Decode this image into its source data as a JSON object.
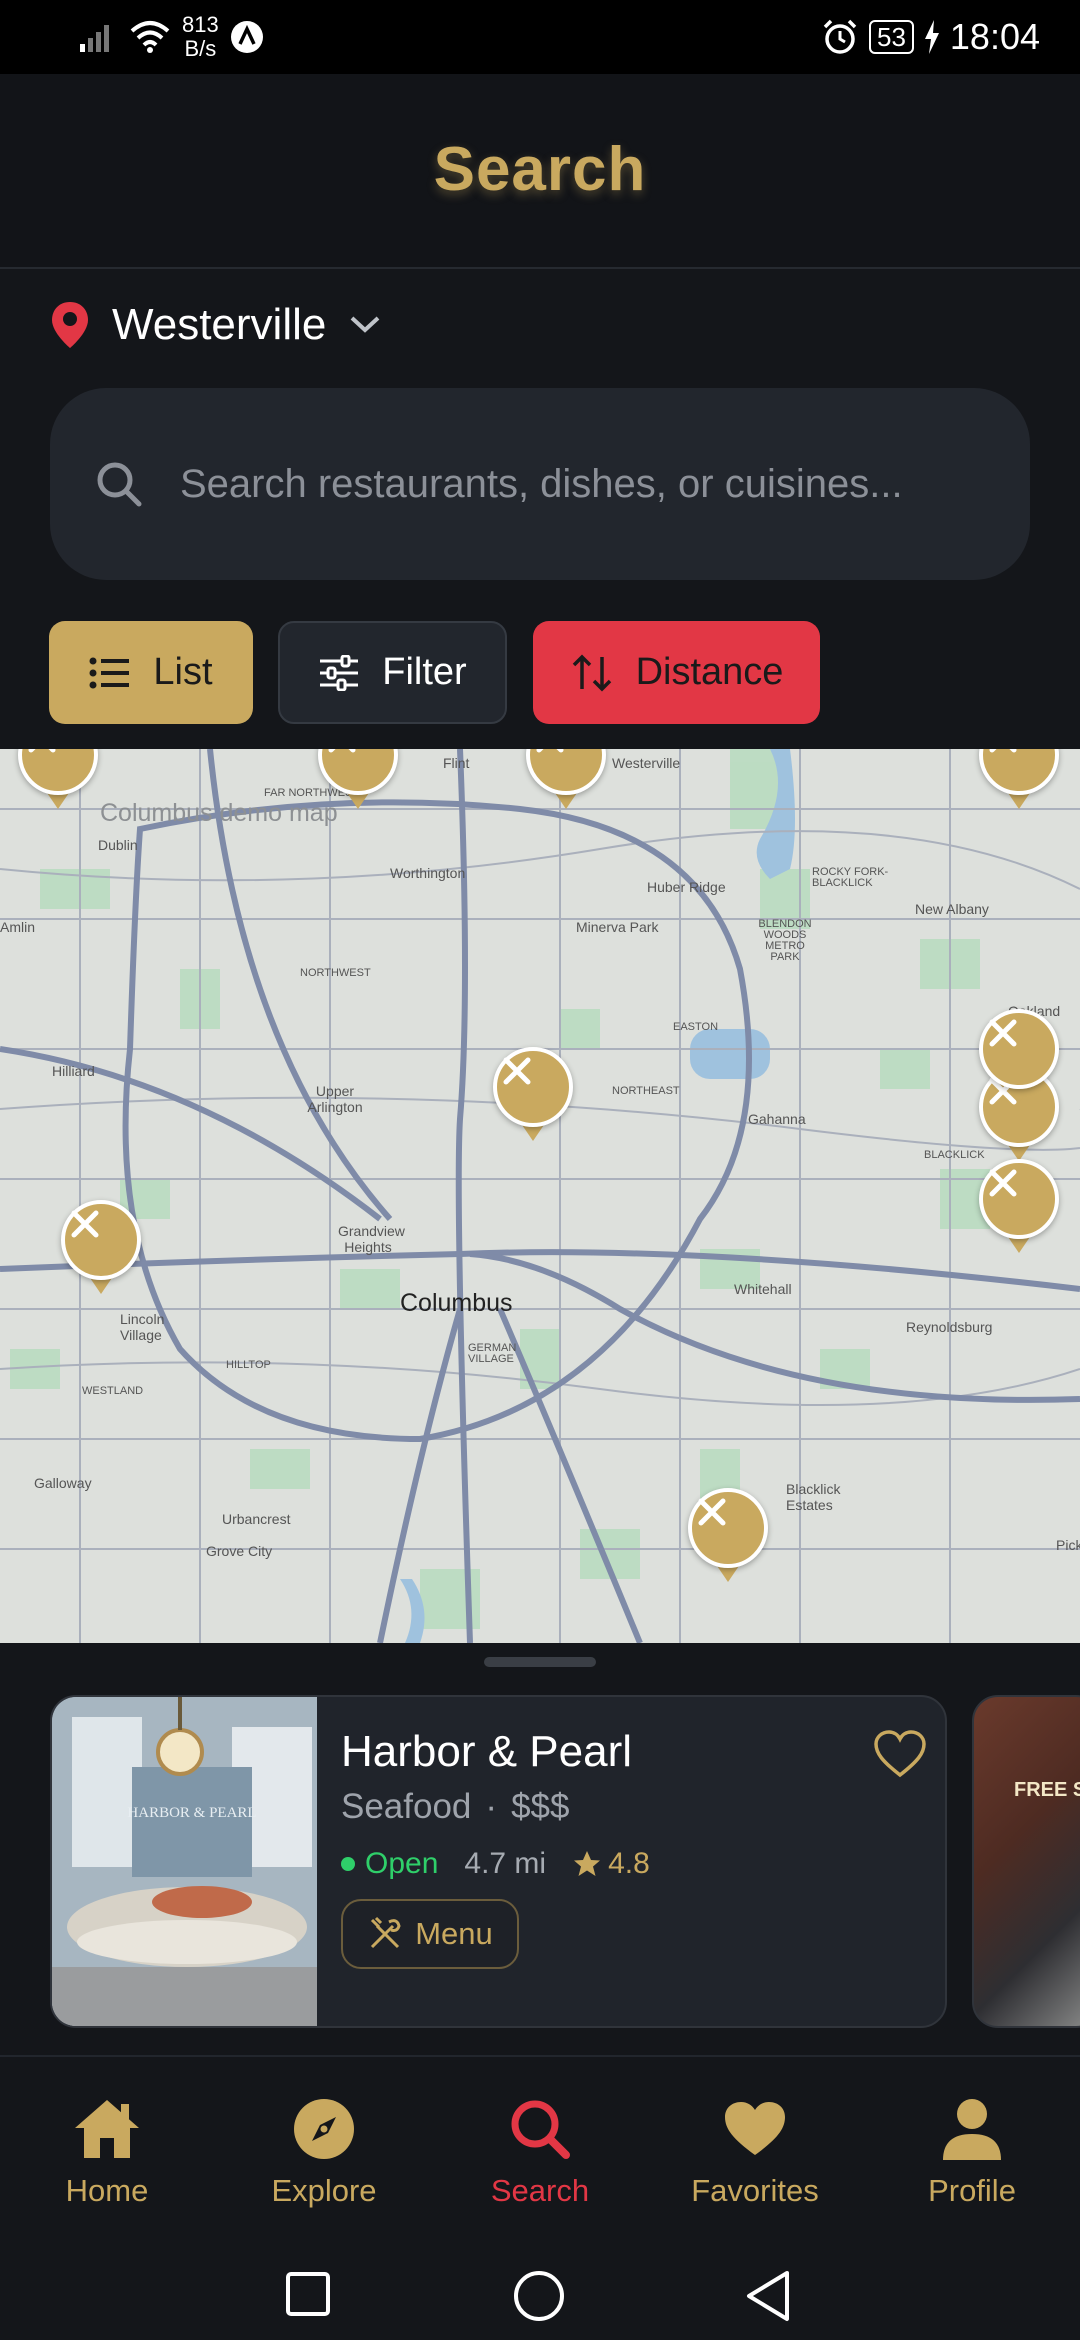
{
  "status_bar": {
    "net_speed": "813",
    "net_unit": "B/s",
    "battery": "53",
    "time": "18:04"
  },
  "header": {
    "title": "Search"
  },
  "location": {
    "label": "Westerville"
  },
  "search": {
    "placeholder": "Search restaurants, dishes, or cuisines..."
  },
  "toolbar": {
    "list_label": "List",
    "filter_label": "Filter",
    "distance_label": "Distance"
  },
  "colors": {
    "accent_gold": "#c9a95f",
    "accent_red": "#e23745",
    "open_green": "#2fcf6a",
    "bg": "#14161a"
  },
  "map": {
    "watermark": "Columbus demo map",
    "labels": {
      "columbus": "Columbus",
      "dublin": "Dublin",
      "flint": "Flint",
      "westerville": "Westerville",
      "far_northwest": "FAR NORTHWEST",
      "worthington": "Worthington",
      "huber_ridge": "Huber Ridge",
      "rocky_fork": "ROCKY FORK-BLACKLICK",
      "new_albany": "New Albany",
      "minerva_park": "Minerva Park",
      "blendon_woods": "BLENDON WOODS METRO PARK",
      "amlin": "Amlin",
      "northwest": "NORTHWEST",
      "oakland": "Oakland",
      "easton": "EASTON",
      "hilliard": "Hilliard",
      "upper_arlington": "Upper Arlington",
      "northeast": "NORTHEAST",
      "gahanna": "Gahanna",
      "blacklick": "BLACKLICK",
      "grandview": "Grandview Heights",
      "whitehall": "Whitehall",
      "lincoln_village": "Lincoln Village",
      "reynoldsburg": "Reynoldsburg",
      "german_village": "GERMAN VILLAGE",
      "hilltop": "HILLTOP",
      "westland": "WESTLAND",
      "galloway": "Galloway",
      "blacklick_estates": "Blacklick Estates",
      "urbancrest": "Urbancrest",
      "grove_city": "Grove City",
      "pick": "Pick"
    },
    "pin_icon": "fork-knife-icon"
  },
  "card": {
    "name": "Harbor & Pearl",
    "cuisine": "Seafood",
    "separator": "·",
    "price": "$$$",
    "status": "Open",
    "distance": "4.7 mi",
    "rating": "4.8",
    "menu_label": "Menu",
    "photo_sign": "HARBOR & PEARL",
    "next_card_sign": "FREE S"
  },
  "nav": {
    "home": "Home",
    "explore": "Explore",
    "search": "Search",
    "favorites": "Favorites",
    "profile": "Profile"
  }
}
